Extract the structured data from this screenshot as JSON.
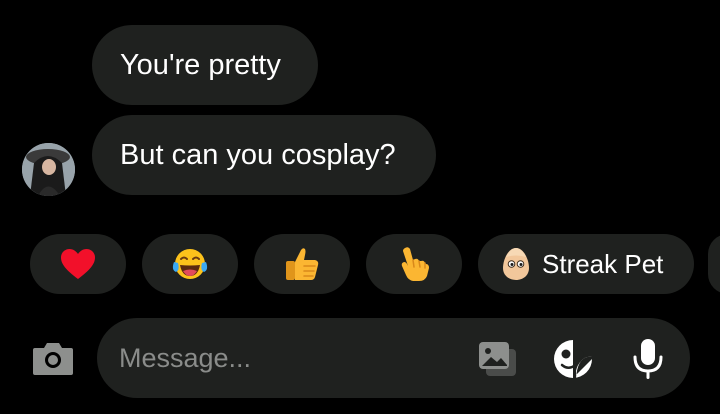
{
  "messages": [
    {
      "text": "You're pretty"
    },
    {
      "text": "But can you cosplay?"
    }
  ],
  "quick_reactions": [
    {
      "icon": "red-heart-icon"
    },
    {
      "icon": "face-with-tears-of-joy-icon"
    },
    {
      "icon": "thumbs-up-icon"
    },
    {
      "icon": "pointing-hand-icon"
    },
    {
      "icon": "egg-pet-icon",
      "label": "Streak Pet"
    }
  ],
  "composer": {
    "placeholder": "Message...",
    "icons": [
      "camera-icon",
      "gallery-icon",
      "sticker-icon",
      "microphone-icon"
    ]
  },
  "colors": {
    "background": "#000000",
    "bubble": "#1f211f",
    "text": "#ffffff",
    "placeholder": "#8a8c8a",
    "icon": "#ffffff",
    "muted_icon": "#8d8f8d"
  }
}
